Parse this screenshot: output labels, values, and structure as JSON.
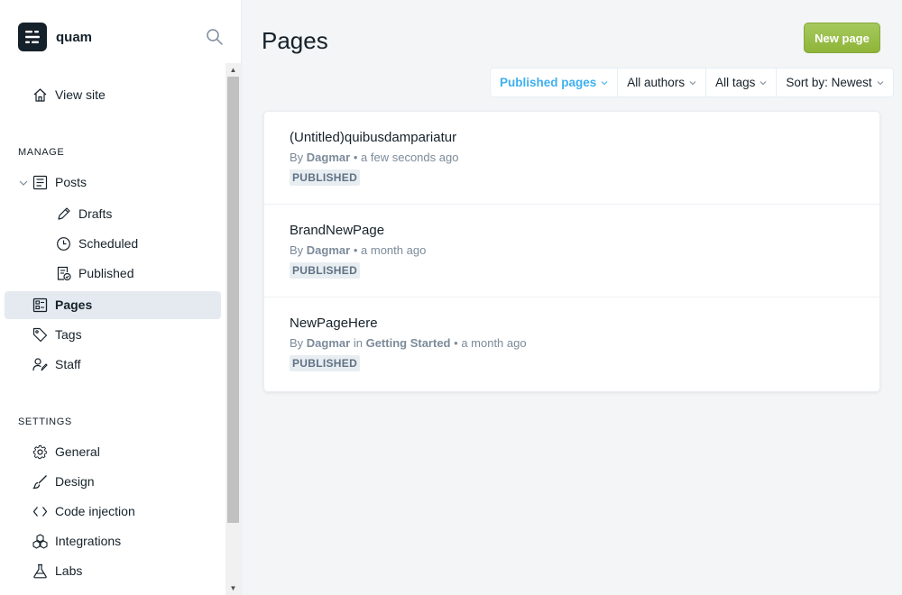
{
  "app": {
    "name": "quam"
  },
  "nav": {
    "view_site": "View site",
    "manage_title": "MANAGE",
    "posts": "Posts",
    "drafts": "Drafts",
    "scheduled": "Scheduled",
    "published": "Published",
    "pages": "Pages",
    "tags": "Tags",
    "staff": "Staff",
    "settings_title": "SETTINGS",
    "general": "General",
    "design": "Design",
    "code_injection": "Code injection",
    "integrations": "Integrations",
    "labs": "Labs"
  },
  "main": {
    "title": "Pages",
    "new_button": "New page",
    "filters": {
      "type": "Published pages",
      "authors": "All authors",
      "tags": "All tags",
      "sort": "Sort by: Newest"
    },
    "pages": [
      {
        "title": "(Untitled)quibusdampariatur",
        "by": "By",
        "author": "Dagmar",
        "in": "",
        "tag": "",
        "sep": "•",
        "time": "a few seconds ago",
        "status": "PUBLISHED"
      },
      {
        "title": "BrandNewPage",
        "by": "By",
        "author": "Dagmar",
        "in": "",
        "tag": "",
        "sep": "•",
        "time": "a month ago",
        "status": "PUBLISHED"
      },
      {
        "title": "NewPageHere",
        "by": "By",
        "author": "Dagmar",
        "in": "in",
        "tag": "Getting Started",
        "sep": "•",
        "time": "a month ago",
        "status": "PUBLISHED"
      }
    ]
  },
  "colors": {
    "accent": "#3eb0ef",
    "button_green": "#9fbb58",
    "text": "#15212a",
    "muted": "#7c8b9a"
  }
}
